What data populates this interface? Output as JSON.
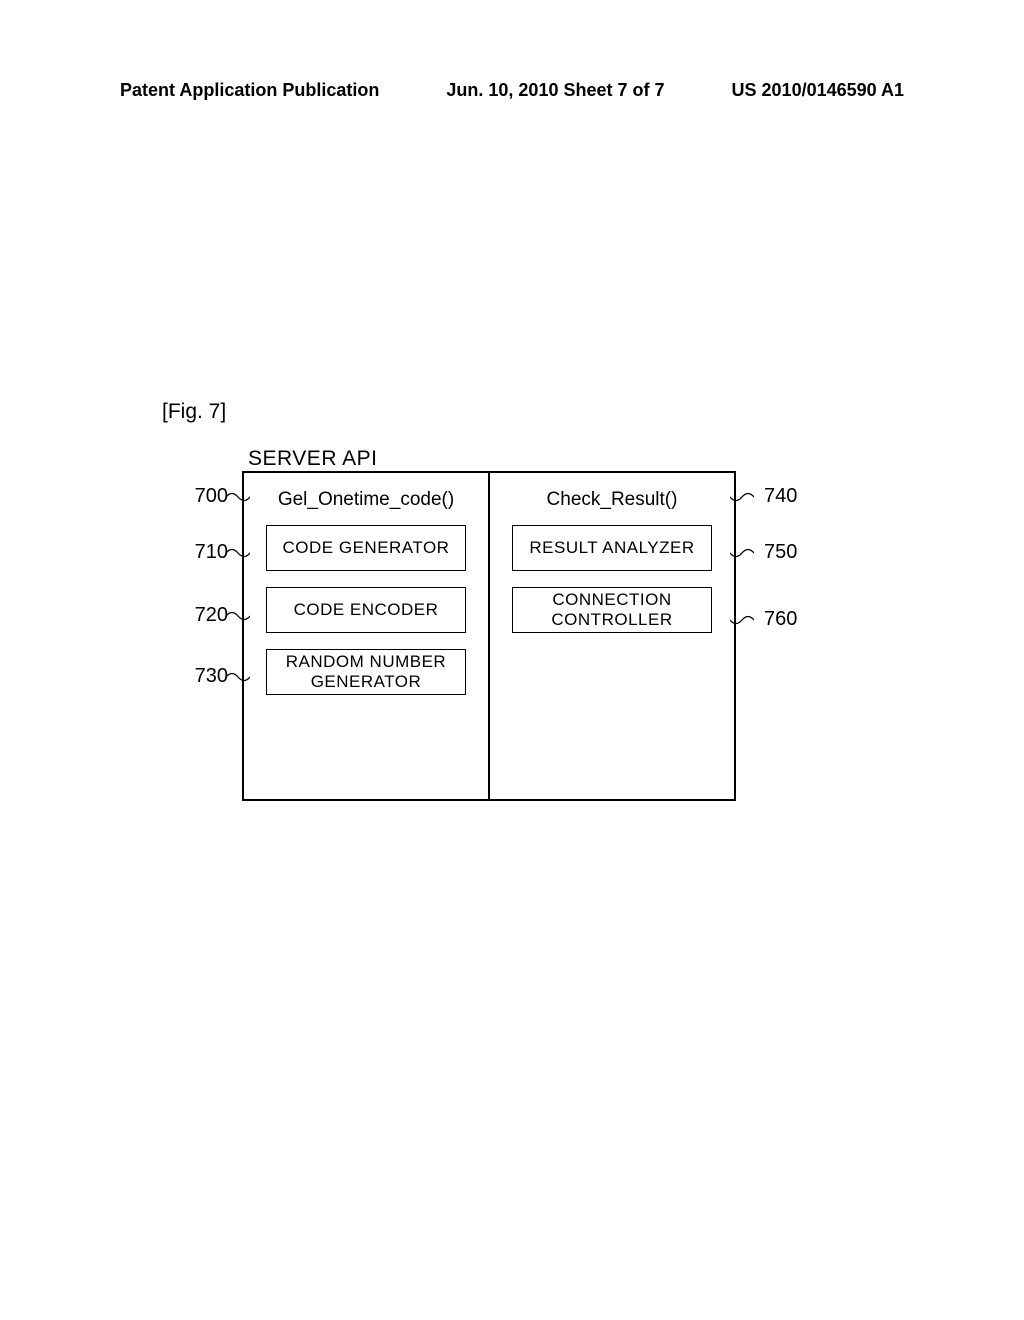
{
  "header": {
    "left": "Patent Application Publication",
    "center": "Jun. 10, 2010  Sheet 7 of 7",
    "right": "US 2010/0146590 A1"
  },
  "figure": {
    "label": "[Fig. 7]",
    "title": "SERVER API",
    "left_column": {
      "api": "Gel_Onetime_code()",
      "boxes": [
        {
          "ref": "700",
          "label_target": "api_left"
        },
        {
          "ref": "710",
          "label": "CODE GENERATOR"
        },
        {
          "ref": "720",
          "label": "CODE ENCODER"
        },
        {
          "ref": "730",
          "label": "RANDOM NUMBER GENERATOR"
        }
      ]
    },
    "right_column": {
      "api": "Check_Result()",
      "boxes": [
        {
          "ref": "740",
          "label_target": "api_right"
        },
        {
          "ref": "750",
          "label": "RESULT ANALYZER"
        },
        {
          "ref": "760",
          "label": "CONNECTION CONTROLLER"
        }
      ]
    }
  },
  "refs": {
    "r700": "700",
    "r710": "710",
    "r720": "720",
    "r730": "730",
    "r740": "740",
    "r750": "750",
    "r760": "760"
  }
}
